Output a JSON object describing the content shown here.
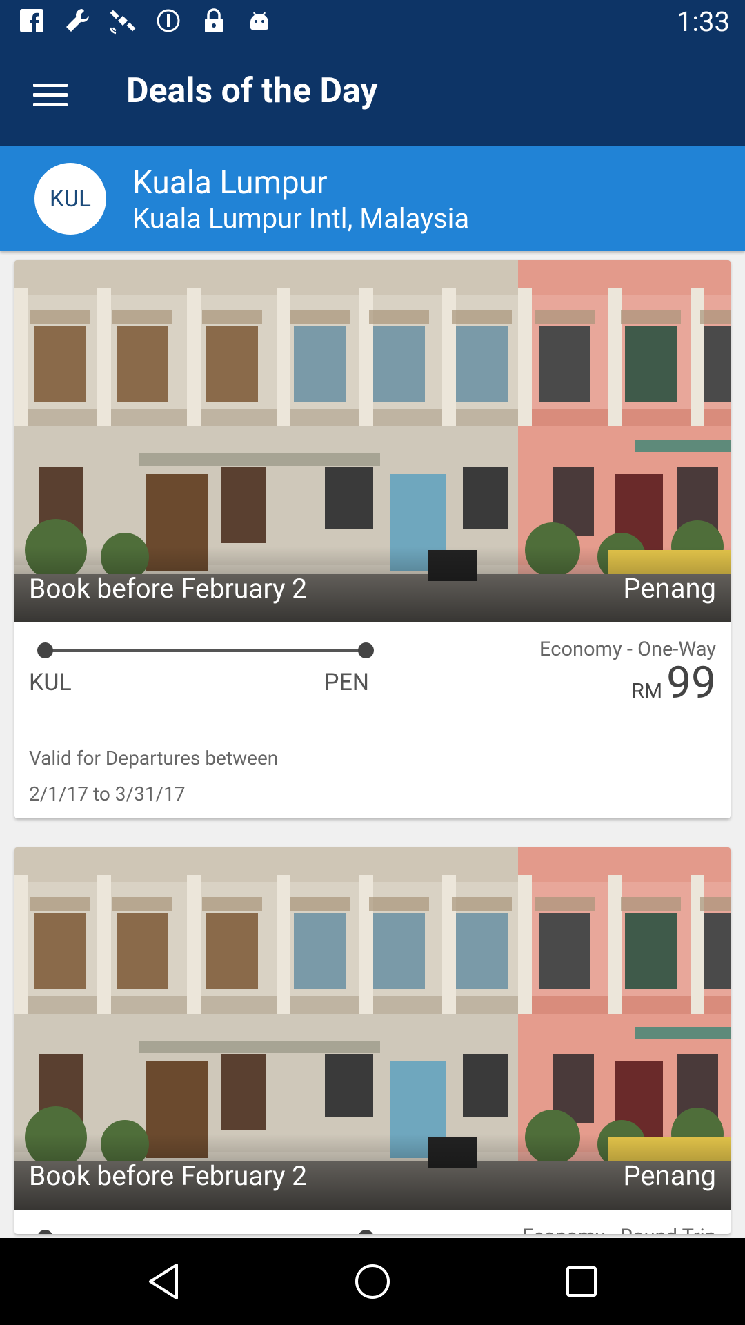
{
  "status_bar": {
    "time": "1:33",
    "icons": [
      "facebook-icon",
      "wrench-icon",
      "satellite-icon",
      "info-icon",
      "lock-icon",
      "android-icon"
    ]
  },
  "app_bar": {
    "title": "Deals of the Day",
    "menu_icon": "hamburger-menu-icon"
  },
  "origin": {
    "code": "KUL",
    "city": "Kuala Lumpur",
    "airport": "Kuala Lumpur Intl, Malaysia"
  },
  "deals": [
    {
      "book_before": "Book before February 2",
      "destination": "Penang",
      "from_code": "KUL",
      "to_code": "PEN",
      "fare_class": "Economy - One-Way",
      "currency": "RM",
      "price": "99",
      "valid_label": "Valid for Departures between",
      "valid_dates": "2/1/17 to 3/31/17"
    },
    {
      "book_before": "Book before February 2",
      "destination": "Penang",
      "fare_class": "Economy - Round Trip"
    }
  ],
  "nav_bar": {
    "icons": [
      "back-icon",
      "home-icon",
      "recents-icon"
    ]
  },
  "colors": {
    "app_bar": "#0d3466",
    "origin_bar": "#2183d6"
  }
}
